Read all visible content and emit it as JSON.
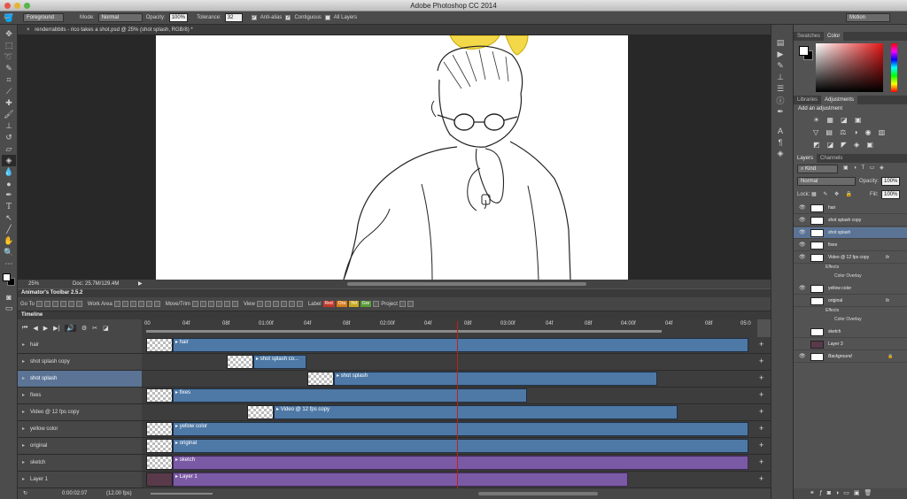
{
  "window": {
    "title": "Adobe Photoshop CC 2014"
  },
  "options": {
    "fill_source": "Foreground",
    "mode_label": "Mode:",
    "mode_value": "Normal",
    "opacity_label": "Opacity:",
    "opacity_value": "100%",
    "tolerance_label": "Tolerance:",
    "tolerance_value": "32",
    "antialias_label": "Anti-alias",
    "contiguous_label": "Contiguous",
    "all_layers_label": "All Layers",
    "workspace": "Motion"
  },
  "document": {
    "tab_title": "renderrabbits - rico takes a shot.psd @ 25% (shot splash, RGB/8) *",
    "zoom": "25%",
    "doc_info": "Doc: 25.7M/129.4M"
  },
  "animator": {
    "title": "Animator's Toolbar 2.5.2",
    "goto": "Go To",
    "work_area": "Work Area",
    "move_trim": "Move/Trim",
    "view": "View",
    "label": "Label",
    "labels": [
      "Red",
      "Ora",
      "Yel",
      "Gre"
    ],
    "label_colors": [
      "#c0392b",
      "#d97b1c",
      "#c9a820",
      "#5a9a3a"
    ],
    "project": "Project"
  },
  "timeline": {
    "title": "Timeline",
    "ruler_ticks": [
      "00",
      "04f",
      "08f",
      "01:00f",
      "04f",
      "08f",
      "02:00f",
      "04f",
      "08f",
      "03:00f",
      "04f",
      "08f",
      "04:00f",
      "04f",
      "08f",
      "05:0"
    ],
    "current_time": "0:00:02:07",
    "fps": "(12.00 fps)",
    "tracks": [
      {
        "name": "hair",
        "clip": "hair",
        "color": "blue"
      },
      {
        "name": "shot splash copy",
        "clip": "shot splash co...",
        "color": "blue"
      },
      {
        "name": "shot splash",
        "clip": "shot splash",
        "color": "blue",
        "selected": true
      },
      {
        "name": "fixes",
        "clip": "fixes",
        "color": "blue"
      },
      {
        "name": "Video @ 12 fps copy",
        "clip": "Video @ 12 fps copy",
        "color": "blue"
      },
      {
        "name": "yellow color",
        "clip": "yellow color",
        "color": "blue"
      },
      {
        "name": "original",
        "clip": "original",
        "color": "blue"
      },
      {
        "name": "sketch",
        "clip": "sketch",
        "color": "purple"
      },
      {
        "name": "Layer 1",
        "clip": "Layer 1",
        "color": "purple"
      }
    ]
  },
  "panels": {
    "swatches_tab": "Swatches",
    "color_tab": "Color",
    "libraries_tab": "Libraries",
    "adjustments_tab": "Adjustments",
    "add_adjustment": "Add an adjustment",
    "layers_tab": "Layers",
    "channels_tab": "Channels",
    "filter_kind": "Kind",
    "blend_mode": "Normal",
    "opacity_label": "Opacity:",
    "opacity_value": "100%",
    "lock_label": "Lock:",
    "fill_label": "Fill:",
    "fill_value": "100%",
    "layers": [
      {
        "name": "hair"
      },
      {
        "name": "shot splash copy"
      },
      {
        "name": "shot splash",
        "selected": true
      },
      {
        "name": "fixes"
      },
      {
        "name": "Video @ 12 fps copy",
        "fx": "fx"
      },
      {
        "name": "Effects"
      },
      {
        "name": "Color Overlay"
      },
      {
        "name": "yellow color"
      },
      {
        "name": "original",
        "fx": "fx"
      },
      {
        "name": "Effects"
      },
      {
        "name": "Color Overlay"
      },
      {
        "name": "sketch"
      },
      {
        "name": "Layer 3"
      },
      {
        "name": "Background"
      }
    ]
  }
}
